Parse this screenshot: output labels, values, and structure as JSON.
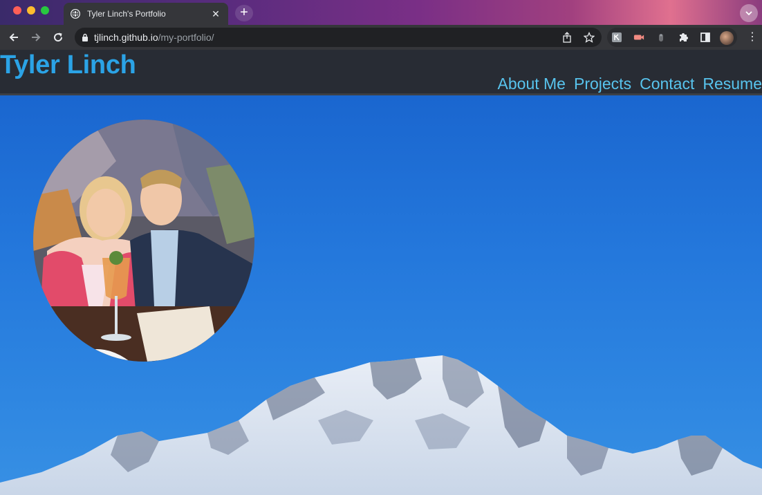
{
  "browser": {
    "tab_title": "Tyler Linch's Portfolio",
    "url_host": "tjlinch.github.io",
    "url_path": "/my-portfolio/"
  },
  "header": {
    "brand": "Tyler Linch",
    "nav": [
      "About Me",
      "Projects",
      "Contact",
      "Resume"
    ]
  },
  "colors": {
    "brand": "#2ba3e6",
    "nav": "#58c4ee",
    "header_bg": "#282c34",
    "sky": "#1e70d6"
  },
  "icons": [
    "globe-icon",
    "close-icon",
    "plus-icon",
    "chevron-down-icon",
    "back-arrow-icon",
    "forward-arrow-icon",
    "reload-icon",
    "lock-icon",
    "share-icon",
    "star-icon",
    "puzzle-icon",
    "sidepanel-icon",
    "kebab-menu-icon"
  ]
}
